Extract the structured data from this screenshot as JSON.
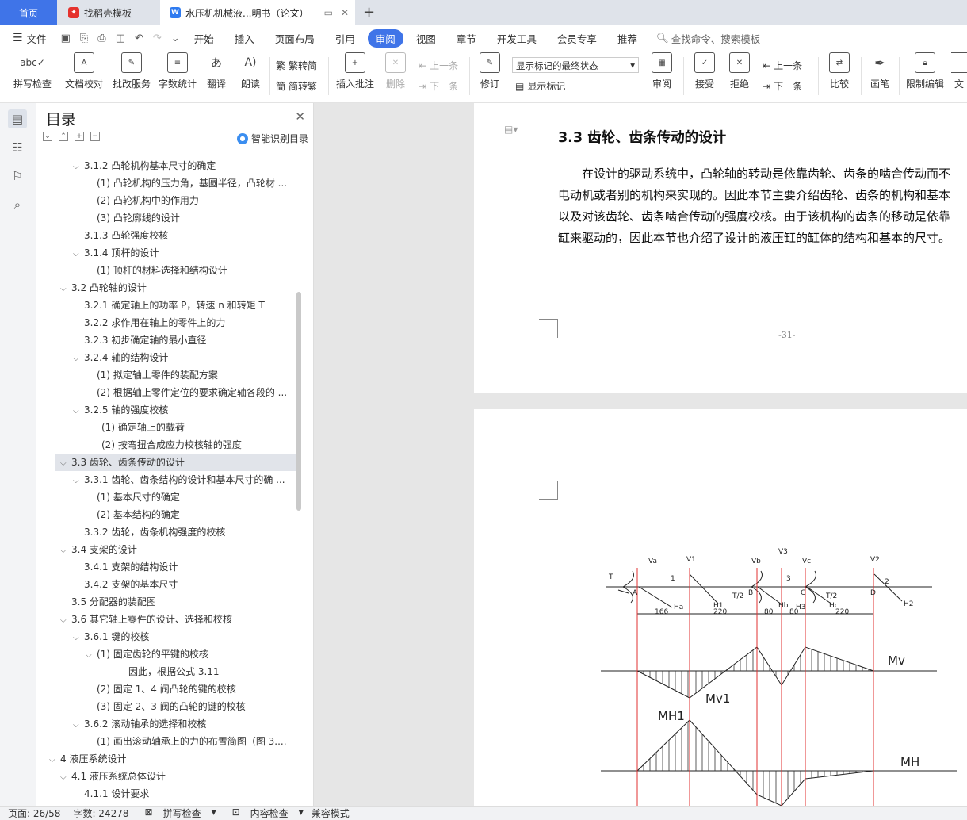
{
  "tabs": {
    "home": "首页",
    "daoke": "找稻壳模板",
    "doc": "水压机机械液...明书（论文）"
  },
  "menu": {
    "file": "文件",
    "items": [
      "开始",
      "插入",
      "页面布局",
      "引用",
      "审阅",
      "视图",
      "章节",
      "开发工具",
      "会员专享",
      "推荐"
    ],
    "active": "审阅",
    "search_placeholder": "查找命令、搜索模板"
  },
  "ribbon": {
    "spellcheck": "拼写检查",
    "doccheck": "文档校对",
    "batch": "批改服务",
    "wordcount": "字数统计",
    "translate": "翻译",
    "read": "朗读",
    "trad2simp": "繁转简",
    "simp2trad": "简转繁",
    "insert_comment": "插入批注",
    "delete": "删除",
    "prev1": "上一条",
    "next1": "下一条",
    "revise": "修订",
    "display_state": "显示标记的最终状态",
    "show_marks": "显示标记",
    "review": "审阅",
    "accept": "接受",
    "reject": "拒绝",
    "prev2": "上一条",
    "next2": "下一条",
    "compare": "比较",
    "pen": "画笔",
    "restrict": "限制编辑",
    "doc_more": "文"
  },
  "toc": {
    "title": "目录",
    "smart": "智能识别目录",
    "items": [
      {
        "text": "3.1.2  凸轮机构基本尺寸的确定",
        "level": 2,
        "caret": "v"
      },
      {
        "text": "(1)  凸轮机构的压力角，基圆半径，凸轮材 ...",
        "level": 3,
        "caret": ""
      },
      {
        "text": "(2)  凸轮机构中的作用力",
        "level": 3,
        "caret": ""
      },
      {
        "text": "(3)  凸轮廓线的设计",
        "level": 3,
        "caret": ""
      },
      {
        "text": "3.1.3  凸轮强度校核",
        "level": 2,
        "caret": ""
      },
      {
        "text": "3.1.4  顶杆的设计",
        "level": 2,
        "caret": "v"
      },
      {
        "text": "(1)  顶杆的材料选择和结构设计",
        "level": 3,
        "caret": ""
      },
      {
        "text": "3.2  凸轮轴的设计",
        "level": 1,
        "caret": "v"
      },
      {
        "text": "3.2.1  确定轴上的功率 P，转速 n 和转矩 T",
        "level": 2,
        "caret": ""
      },
      {
        "text": "3.2.2  求作用在轴上的零件上的力",
        "level": 2,
        "caret": ""
      },
      {
        "text": "3.2.3 初步确定轴的最小直径",
        "level": 2,
        "caret": ""
      },
      {
        "text": "3.2.4  轴的结构设计",
        "level": 2,
        "caret": "v"
      },
      {
        "text": "(1)  拟定轴上零件的装配方案",
        "level": 3,
        "caret": ""
      },
      {
        "text": "(2)  根据轴上零件定位的要求确定轴各段的 ...",
        "level": 3,
        "caret": ""
      },
      {
        "text": "3.2.5 轴的强度校核",
        "level": 2,
        "caret": "v"
      },
      {
        "text": "(1)  确定轴上的载荷",
        "level": 3.3,
        "caret": ""
      },
      {
        "text": "(2)  按弯扭合成应力校核轴的强度",
        "level": 3.3,
        "caret": ""
      },
      {
        "text": "3.3  齿轮、齿条传动的设计",
        "level": 1,
        "caret": "v",
        "selected": true
      },
      {
        "text": "3.3.1  齿轮、齿条结构的设计和基本尺寸的确 ...",
        "level": 2,
        "caret": "v"
      },
      {
        "text": "(1)  基本尺寸的确定",
        "level": 3,
        "caret": ""
      },
      {
        "text": "(2)  基本结构的确定",
        "level": 3,
        "caret": ""
      },
      {
        "text": "3.3.2  齿轮，齿条机构强度的校核",
        "level": 2,
        "caret": ""
      },
      {
        "text": "3.4  支架的设计",
        "level": 1,
        "caret": "v"
      },
      {
        "text": "3.4.1  支架的结构设计",
        "level": 2,
        "caret": ""
      },
      {
        "text": "3.4.2 支架的基本尺寸",
        "level": 2,
        "caret": ""
      },
      {
        "text": "3.5  分配器的装配图",
        "level": 1,
        "caret": ""
      },
      {
        "text": "3.6  其它轴上零件的设计、选择和校核",
        "level": 1,
        "caret": "v"
      },
      {
        "text": "3.6.1  键的校核",
        "level": 2,
        "caret": "v"
      },
      {
        "text": "(1)  固定齿轮的平键的校核",
        "level": 2.7,
        "caret": "v"
      },
      {
        "text": "因此，根据公式 3.11",
        "level": 4,
        "caret": ""
      },
      {
        "text": "(2)  固定 1、4 阀凸轮的键的校核",
        "level": 3,
        "caret": ""
      },
      {
        "text": "(3)  固定 2、3 阀的凸轮的键的校核",
        "level": 3,
        "caret": ""
      },
      {
        "text": "3.6.2  滚动轴承的选择和校核",
        "level": 2,
        "caret": "v"
      },
      {
        "text": "(1)  画出滚动轴承上的力的布置简图（图 3....",
        "level": 3,
        "caret": ""
      },
      {
        "text": "4    液压系统设计",
        "level": 0,
        "caret": "v"
      },
      {
        "text": "4.1  液压系统总体设计",
        "level": 1,
        "caret": "v"
      },
      {
        "text": "4.1.1  设计要求",
        "level": 2,
        "caret": ""
      }
    ]
  },
  "doc": {
    "heading": "3.3  齿轮、齿条传动的设计",
    "para_lines": [
      "　　在设计的驱动系统中，凸轮轴的转动是依靠齿轮、齿条的啮合传动而不",
      "电动机或者别的机构来实现的。因此本节主要介绍齿轮、齿条的机构和基本",
      "以及对该齿轮、齿条啮合传动的强度校核。由于该机构的齿条的移动是依靠",
      "缸来驱动的，因此本节也介绍了设计的液压缸的缸体的结构和基本的尺寸。"
    ],
    "page_number": "-31-"
  },
  "diagram": {
    "top_labels": [
      "Va",
      "V1",
      "Vb",
      "V3",
      "Vc",
      "V2"
    ],
    "load_labels": [
      "T",
      "1",
      "3",
      "2",
      "A",
      "B",
      "C",
      "D",
      "T/2",
      "T/2",
      "Ha",
      "H1",
      "Hb",
      "H3",
      "Hc",
      "H2"
    ],
    "dims": [
      "166",
      "220",
      "80",
      "80",
      "220"
    ],
    "mv_label": "Mv",
    "mv1_label": "Mv1",
    "mh1_label": "MH1",
    "mh_label": "MH"
  },
  "status": {
    "page": "页面: 26/58",
    "words": "字数: 24278",
    "spell": "拼写检查",
    "content": "内容检查",
    "compat": "兼容模式"
  },
  "colors": {
    "accent": "#3f74e8",
    "red_lines": "#e03030"
  }
}
